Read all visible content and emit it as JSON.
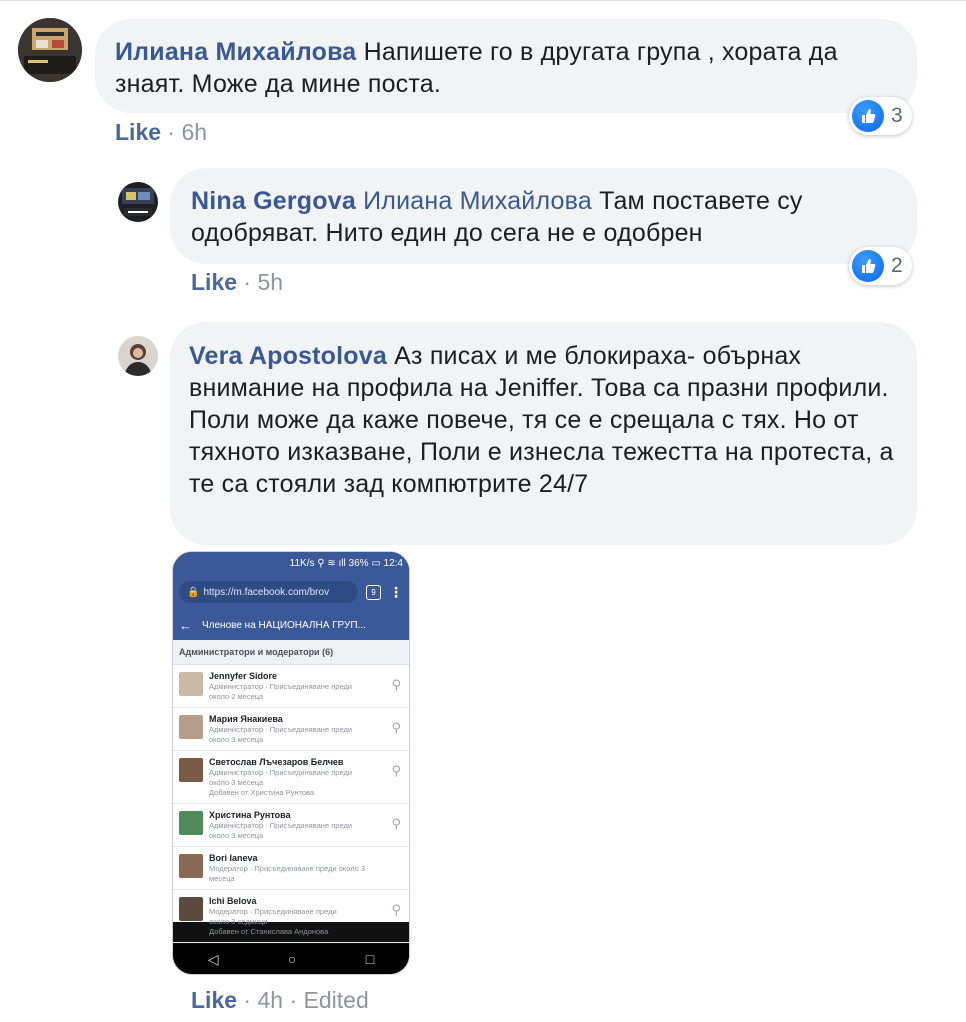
{
  "comments": [
    {
      "author": "Илиана Михайлова",
      "text": "Напишете го в другата група , хората да знаят. Може да мине поста.",
      "like_label": "Like",
      "separator": "·",
      "time": "6h",
      "reaction_count": "3"
    },
    {
      "author": "Nina Gergova",
      "mention": "Илиана Михайлова",
      "text": "Там поставете су одобряват. Нито един до сега не е одобрен",
      "like_label": "Like",
      "separator": "·",
      "time": "5h",
      "reaction_count": "2"
    },
    {
      "author": "Vera Apostolova",
      "text": "Аз писах и ме блокираха- обърнах внимание на профила на Jeniffer. Това са празни профили. Поли може да каже повече, тя се е срещала с тях. Но от тяхното изказване, Поли е изнесла тежестта на протеста, а те са стояли зад компютрите 24/7",
      "like_label": "Like",
      "separator": "·",
      "time": "4h",
      "edited": "Edited"
    }
  ],
  "attachment": {
    "status_bar": "11K/s ⚲ ≋ ıll 36% ▭ 12:4",
    "url": "https://m.facebook.com/brov",
    "tabs_count": "9",
    "title": "Членове на НАЦИОНАЛНА ГРУП...",
    "section": "Администратори и модератори (6)",
    "members": [
      {
        "name": "Jennyfer Sidore",
        "detail": [
          "Администратор · Присъединяване преди",
          "около 2 месеца"
        ],
        "color": "#c9b9a6"
      },
      {
        "name": "Мария Янакиева",
        "detail": [
          "Администратор · Присъединяване преди",
          "около 3 месеца"
        ],
        "color": "#b59f8c"
      },
      {
        "name": "Светослав Лъчезаров Белчев",
        "detail": [
          "Администратор · Присъединяване преди",
          "около 3 месеца",
          "Добавен от Христина Рунтова"
        ],
        "color": "#7a5a44"
      },
      {
        "name": "Христина Рунтова",
        "detail": [
          "Администратор · Присъединяване преди",
          "около 3 месеца"
        ],
        "color": "#4f8a5b"
      },
      {
        "name": "Bori Ianeva",
        "detail": [
          "Модератор · Присъединяване преди около 3",
          "месеца"
        ],
        "color": "#8a6a55"
      },
      {
        "name": "Ichi Belova",
        "detail": [
          "Модератор · Присъединяване преди",
          "около 3 седмици",
          "Добавен от Станислава Андонова"
        ],
        "color": "#5c4a3e"
      }
    ]
  },
  "colors": {
    "link": "#385898",
    "bubble": "#f2f3f5",
    "meta": "#90949c",
    "fb_blue": "#3b5998"
  }
}
